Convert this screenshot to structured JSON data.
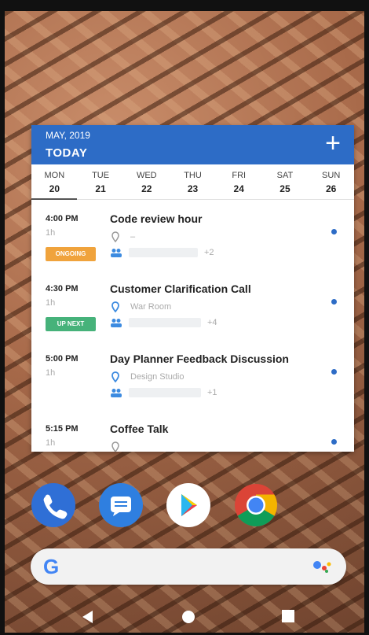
{
  "widget": {
    "month_label": "MAY, 2019",
    "today_label": "TODAY",
    "add_label": "+",
    "days": [
      {
        "name": "MON",
        "date": "20"
      },
      {
        "name": "TUE",
        "date": "21"
      },
      {
        "name": "WED",
        "date": "22"
      },
      {
        "name": "THU",
        "date": "23"
      },
      {
        "name": "FRI",
        "date": "24"
      },
      {
        "name": "SAT",
        "date": "25"
      },
      {
        "name": "SUN",
        "date": "26"
      }
    ],
    "events": [
      {
        "time": "4:00 PM",
        "duration": "1h",
        "badge": "ONGOING",
        "badge_color": "#f0a33c",
        "title": "Code review hour",
        "location": "–",
        "location_active": false,
        "extra_attendees": "+2"
      },
      {
        "time": "4:30 PM",
        "duration": "1h",
        "badge": "UP NEXT",
        "badge_color": "#46b27a",
        "title": "Customer Clarification Call",
        "location": "War Room",
        "location_active": true,
        "extra_attendees": "+4"
      },
      {
        "time": "5:00 PM",
        "duration": "1h",
        "badge": "",
        "badge_color": "",
        "title": "Day Planner Feedback Discussion",
        "location": "Design Studio",
        "location_active": true,
        "extra_attendees": "+1"
      },
      {
        "time": "5:15 PM",
        "duration": "1h",
        "badge": "",
        "badge_color": "",
        "title": "Coffee Talk",
        "location": "",
        "location_active": false,
        "extra_attendees": ""
      }
    ],
    "accent_color": "#2d6cc6"
  },
  "dock": {
    "apps": [
      {
        "name": "Phone",
        "icon": "phone-icon"
      },
      {
        "name": "Messages",
        "icon": "messages-icon"
      },
      {
        "name": "Play Store",
        "icon": "play-store-icon"
      },
      {
        "name": "Chrome",
        "icon": "chrome-icon"
      }
    ]
  },
  "search": {
    "logo": "G",
    "assistant_icon": "google-assistant-icon"
  },
  "nav": {
    "back": "back-icon",
    "home": "home-icon",
    "recents": "recents-icon"
  }
}
